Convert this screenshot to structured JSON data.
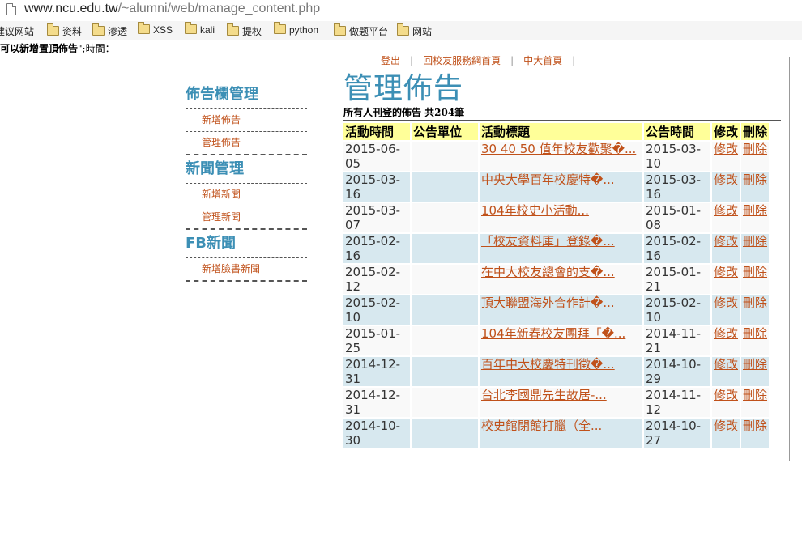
{
  "browser": {
    "url_host": "www.ncu.edu.tw",
    "url_path": "/~alumni/web/manage_content.php",
    "bookmarks": [
      "建议网站",
      "资料",
      "渗透",
      "XSS",
      "kali",
      "提权",
      "python",
      "做题平台",
      "网站"
    ]
  },
  "notice": {
    "bold": "可以新增置頂佈告",
    "rest": "\";時間："
  },
  "topnav": {
    "logout": "登出",
    "alumni_home": "回校友服務網首頁",
    "ncu_home": "中大首頁"
  },
  "sidebar": {
    "sections": [
      {
        "title": "佈告欄管理",
        "items": [
          "新增佈告",
          "管理佈告"
        ]
      },
      {
        "title": "新聞管理",
        "items": [
          "新增新聞",
          "管理新聞"
        ]
      },
      {
        "title": "FB新聞",
        "items": [
          "新增臉書新聞"
        ]
      }
    ]
  },
  "main": {
    "title": "管理佈告",
    "count_label": "所有人刊登的佈告 共204筆",
    "columns": [
      "活動時間",
      "公告單位",
      "活動標題",
      "公告時間",
      "修改",
      "刪除"
    ],
    "rows": [
      {
        "event_date": "2015-06-05",
        "unit": "",
        "title": "30 40 50 值年校友歡聚�...",
        "post_date": "2015-03-10",
        "edit": "修改",
        "delete": "刪除"
      },
      {
        "event_date": "2015-03-16",
        "unit": "",
        "title": "中央大學百年校慶特�...",
        "post_date": "2015-03-16",
        "edit": "修改",
        "delete": "刪除"
      },
      {
        "event_date": "2015-03-07",
        "unit": "",
        "title": "104年校史小活動...",
        "post_date": "2015-01-08",
        "edit": "修改",
        "delete": "刪除"
      },
      {
        "event_date": "2015-02-16",
        "unit": "",
        "title": "「校友資料庫」登錄�...",
        "post_date": "2015-02-16",
        "edit": "修改",
        "delete": "刪除"
      },
      {
        "event_date": "2015-02-12",
        "unit": "",
        "title": "在中大校友總會的支�...",
        "post_date": "2015-01-21",
        "edit": "修改",
        "delete": "刪除"
      },
      {
        "event_date": "2015-02-10",
        "unit": "",
        "title": "頂大聯盟海外合作計�...",
        "post_date": "2015-02-10",
        "edit": "修改",
        "delete": "刪除"
      },
      {
        "event_date": "2015-01-25",
        "unit": "",
        "title": "104年新春校友團拜「�...",
        "post_date": "2014-11-21",
        "edit": "修改",
        "delete": "刪除"
      },
      {
        "event_date": "2014-12-31",
        "unit": "",
        "title": "百年中大校慶特刊徵�...",
        "post_date": "2014-10-29",
        "edit": "修改",
        "delete": "刪除"
      },
      {
        "event_date": "2014-12-31",
        "unit": "",
        "title": "台北李國鼎先生故居-...",
        "post_date": "2014-11-12",
        "edit": "修改",
        "delete": "刪除"
      },
      {
        "event_date": "2014-10-30",
        "unit": "",
        "title": "校史館閉館打臘（全...",
        "post_date": "2014-10-27",
        "edit": "修改",
        "delete": "刪除"
      }
    ]
  },
  "colors": {
    "accent_blue": "#3c8fb5",
    "link_orange": "#c0511a",
    "header_yellow": "#ffff99",
    "row_blue": "#d7e8ef"
  }
}
